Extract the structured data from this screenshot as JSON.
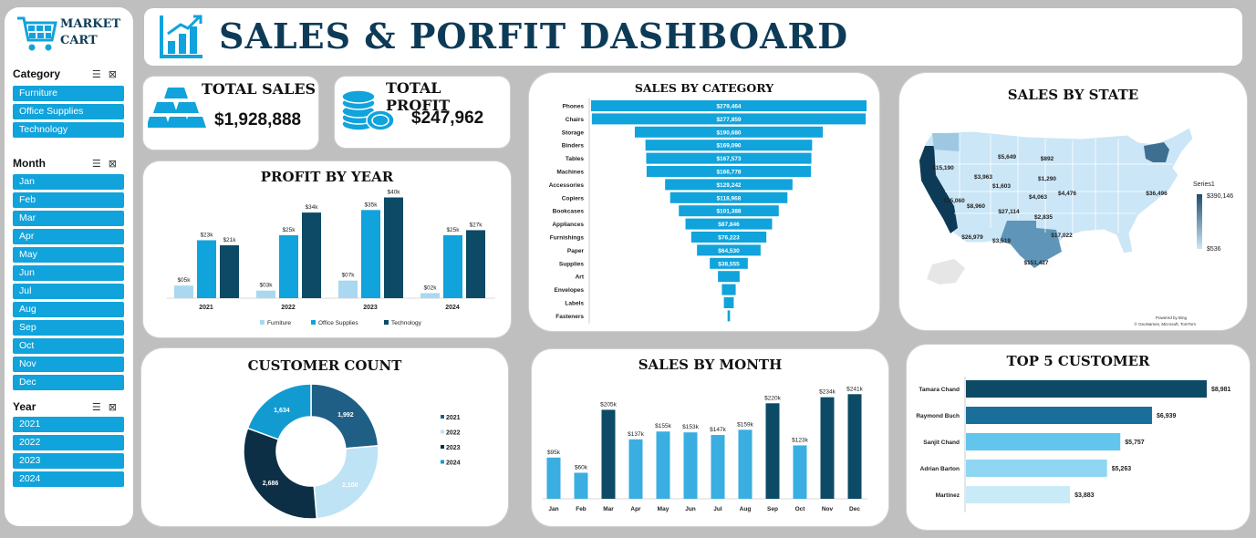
{
  "brand": {
    "line1": "MARKET",
    "line2": "CART"
  },
  "header": {
    "title": "SALES & PORFIT DASHBOARD"
  },
  "colors": {
    "primary": "#11a3db",
    "dark": "#0d3b57",
    "mid": "#1f4e79",
    "light": "#a9d8f0"
  },
  "slicers": {
    "category": {
      "title": "Category",
      "items": [
        "Furniture",
        "Office Supplies",
        "Technology"
      ]
    },
    "month": {
      "title": "Month",
      "items": [
        "Jan",
        "Feb",
        "Mar",
        "Apr",
        "May",
        "Jun",
        "Jul",
        "Aug",
        "Sep",
        "Oct",
        "Nov",
        "Dec"
      ]
    },
    "year": {
      "title": "Year",
      "items": [
        "2021",
        "2022",
        "2023",
        "2024"
      ]
    }
  },
  "kpis": {
    "total_sales": {
      "label": "TOTAL SALES",
      "value": "$1,928,888",
      "icon": "gold-bars-icon"
    },
    "total_profit": {
      "label": "TOTAL PROFIT",
      "value": "$247,962",
      "icon": "coins-icon"
    }
  },
  "chart_data": [
    {
      "id": "profit_by_year",
      "type": "bar",
      "title": "PROFIT BY YEAR",
      "categories": [
        "2021",
        "2022",
        "2023",
        "2024"
      ],
      "series": [
        {
          "name": "Furniture",
          "color": "#a9d8f0",
          "values": [
            5,
            3,
            7,
            2
          ],
          "labels": [
            "$05k",
            "$03k",
            "$07k",
            "$02k"
          ]
        },
        {
          "name": "Office Supplies",
          "color": "#11a3db",
          "values": [
            23,
            25,
            35,
            25
          ],
          "labels": [
            "$23k",
            "$25k",
            "$35k",
            "$25k"
          ]
        },
        {
          "name": "Technology",
          "color": "#0d4a66",
          "values": [
            21,
            34,
            40,
            27
          ],
          "labels": [
            "$21k",
            "$34k",
            "$40k",
            "$27k"
          ]
        }
      ],
      "ylim": [
        0,
        42
      ]
    },
    {
      "id": "sales_by_category",
      "type": "bar",
      "title": "SALES BY CATEGORY",
      "orientation": "horizontal-funnel",
      "categories": [
        "Phones",
        "Chairs",
        "Storage",
        "Binders",
        "Tables",
        "Machines",
        "Accessories",
        "Copiers",
        "Bookcases",
        "Appliances",
        "Furnishings",
        "Paper",
        "Supplies",
        "Art",
        "Envelopes",
        "Labels",
        "Fasteners"
      ],
      "values": [
        279464,
        277859,
        190680,
        169090,
        167573,
        166778,
        129242,
        118968,
        101388,
        87846,
        76223,
        64530,
        38555,
        22000,
        14000,
        10000,
        2500
      ],
      "labels": [
        "$279,464",
        "$277,859",
        "$190,680",
        "$169,090",
        "$167,573",
        "$166,778",
        "$129,242",
        "$118,968",
        "$101,388",
        "$87,846",
        "$76,223",
        "$64,530",
        "$38,555",
        "",
        "",
        "",
        ""
      ]
    },
    {
      "id": "sales_by_state",
      "type": "map",
      "title": "SALES BY STATE",
      "legend_title": "Series1",
      "legend_max": "$390,146",
      "legend_min": "$536",
      "labels": [
        "$15,190",
        "$3,963",
        "$5,649",
        "$892",
        "$1,290",
        "$15,060",
        "$8,960",
        "$1,603",
        "$4,063",
        "$4,476",
        "$36,496",
        "$27,114",
        "$2,835",
        "$26,979",
        "$3,519",
        "$17,022",
        "$151,427"
      ],
      "credit1": "Powered by Bing",
      "credit2": "© GeoNames, Microsoft, TomTom"
    },
    {
      "id": "customer_count",
      "type": "pie",
      "title": "CUSTOMER COUNT",
      "categories": [
        "2021",
        "2022",
        "2023",
        "2024"
      ],
      "values": [
        1992,
        2100,
        2686,
        1634
      ],
      "colors": [
        "#1f5f86",
        "#bde3f5",
        "#0d2f45",
        "#129bd1"
      ],
      "legend": [
        "2021",
        "2022",
        "2023",
        "2024"
      ]
    },
    {
      "id": "sales_by_month",
      "type": "bar",
      "title": "SALES BY MONTH",
      "categories": [
        "Jan",
        "Feb",
        "Mar",
        "Apr",
        "May",
        "Jun",
        "Jul",
        "Aug",
        "Sep",
        "Oct",
        "Nov",
        "Dec"
      ],
      "values": [
        95,
        60,
        205,
        137,
        155,
        153,
        147,
        159,
        220,
        123,
        234,
        241
      ],
      "labels": [
        "$95k",
        "$60k",
        "$205k",
        "$137k",
        "$155k",
        "$153k",
        "$147k",
        "$159k",
        "$220k",
        "$123k",
        "$234k",
        "$241k"
      ],
      "ylim": [
        0,
        250
      ]
    },
    {
      "id": "top5_customer",
      "type": "bar",
      "title": "TOP 5 CUSTOMER",
      "orientation": "horizontal",
      "categories": [
        "Tamara Chand",
        "Raymond Buch",
        "Sanjit Chand",
        "Adrian Barton",
        "Martinez"
      ],
      "values": [
        8981,
        6939,
        5757,
        5263,
        3883
      ],
      "labels": [
        "$8,981",
        "$6,939",
        "$5,757",
        "$5,263",
        "$3,883"
      ],
      "colors": [
        "#0d4a66",
        "#1a6f9a",
        "#62c6ec",
        "#8fd6f2",
        "#c9ebf8"
      ]
    }
  ]
}
